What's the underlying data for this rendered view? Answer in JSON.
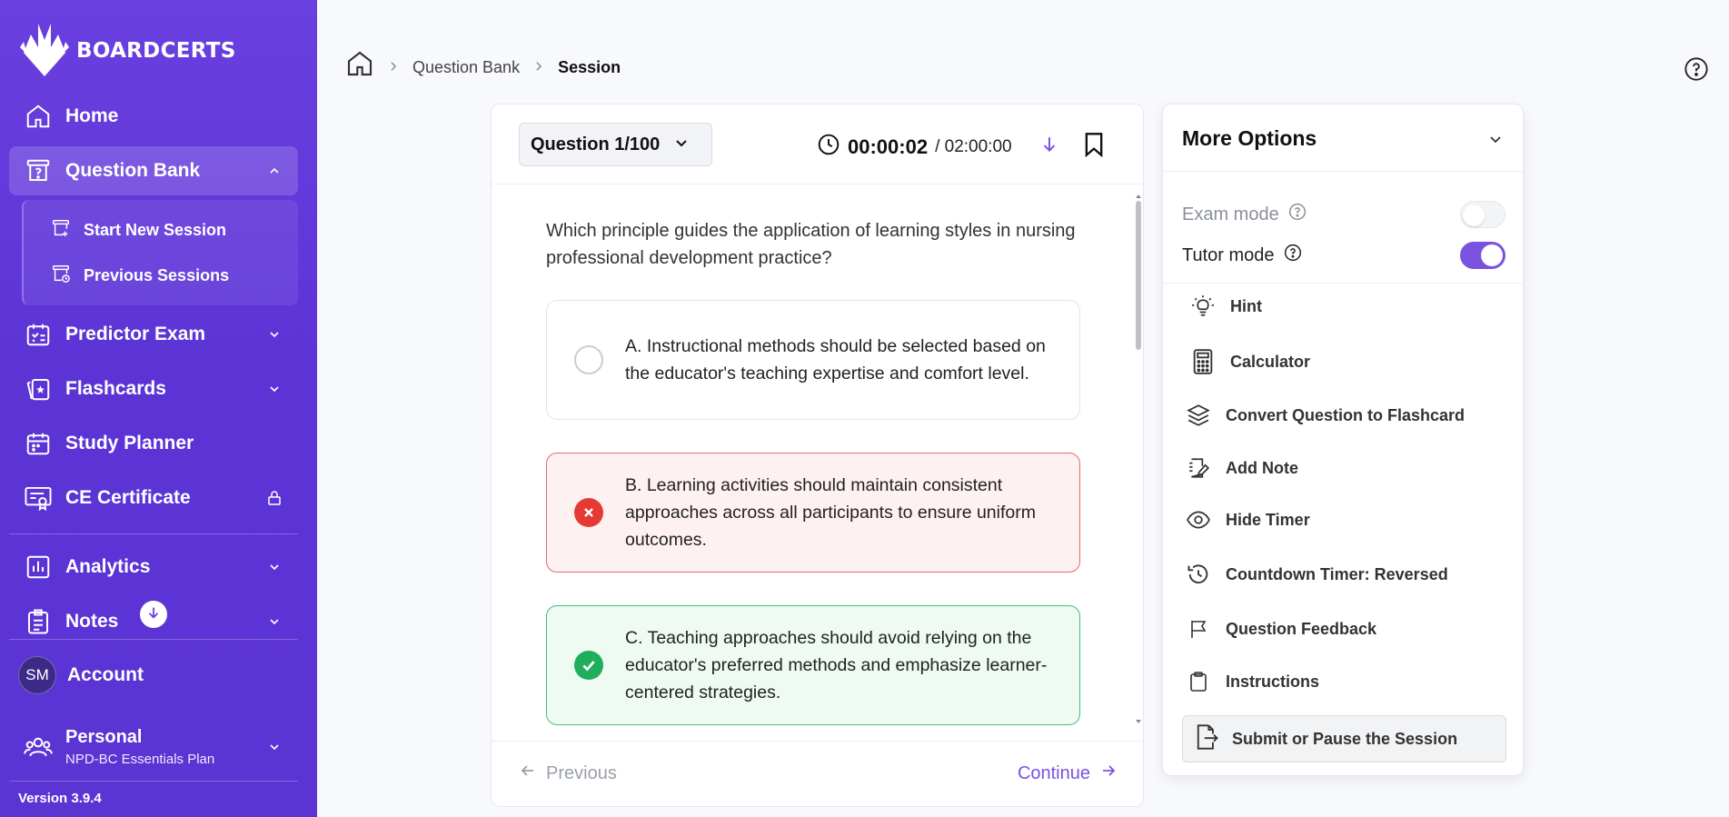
{
  "brand": {
    "name": "BOARDCERTS"
  },
  "sidebar": {
    "items": [
      {
        "label": "Home",
        "icon": "home-icon"
      },
      {
        "label": "Question Bank",
        "icon": "question-bank-icon"
      },
      {
        "label": "Predictor Exam",
        "icon": "predictor-exam-icon"
      },
      {
        "label": "Flashcards",
        "icon": "flashcards-icon"
      },
      {
        "label": "Study Planner",
        "icon": "calendar-icon"
      },
      {
        "label": "CE Certificate",
        "icon": "certificate-icon"
      },
      {
        "label": "Analytics",
        "icon": "analytics-icon"
      },
      {
        "label": "Notes",
        "icon": "notes-icon"
      }
    ],
    "sub_items": [
      {
        "label": "Start New Session",
        "icon": "start-session-icon"
      },
      {
        "label": "Previous Sessions",
        "icon": "previous-sessions-icon"
      }
    ],
    "account": {
      "label": "Account",
      "initials": "SM"
    },
    "workspace": {
      "name": "Personal",
      "plan": "NPD-BC Essentials Plan"
    },
    "version": "Version 3.9.4"
  },
  "breadcrumb": {
    "items": [
      "Question Bank",
      "Session"
    ]
  },
  "question": {
    "selector_label": "Question 1/100",
    "timer_elapsed": "00:00:02",
    "timer_total": "/ 02:00:00",
    "text": "Which principle guides the application of learning styles in nursing professional development practice?",
    "options": [
      {
        "text": "A. Instructional methods should be selected based on the educator's teaching expertise and comfort level.",
        "state": "unselected"
      },
      {
        "text": "B. Learning activities should maintain consistent approaches across all participants to ensure uniform outcomes.",
        "state": "incorrect"
      },
      {
        "text": "C. Teaching approaches should avoid relying on the educator's preferred methods and emphasize learner-centered strategies.",
        "state": "correct"
      }
    ],
    "prev_label": "Previous",
    "next_label": "Continue"
  },
  "options_panel": {
    "title": "More Options",
    "modes": [
      {
        "label": "Exam mode",
        "enabled": false
      },
      {
        "label": "Tutor mode",
        "enabled": true
      }
    ],
    "items": [
      {
        "label": "Hint",
        "icon": "lightbulb-icon"
      },
      {
        "label": "Calculator",
        "icon": "calculator-icon"
      },
      {
        "label": "Convert Question to Flashcard",
        "icon": "layers-icon"
      },
      {
        "label": "Add Note",
        "icon": "note-edit-icon"
      },
      {
        "label": "Hide Timer",
        "icon": "eye-icon"
      },
      {
        "label": "Countdown Timer: Reversed",
        "icon": "history-icon"
      },
      {
        "label": "Question Feedback",
        "icon": "flag-icon"
      },
      {
        "label": "Instructions",
        "icon": "clipboard-icon"
      }
    ],
    "submit_label": "Submit or Pause the Session"
  },
  "colors": {
    "sidebar": "#6a3fe0",
    "accent": "#7b52e0",
    "incorrect": "#e53935",
    "correct": "#1fae5b"
  }
}
